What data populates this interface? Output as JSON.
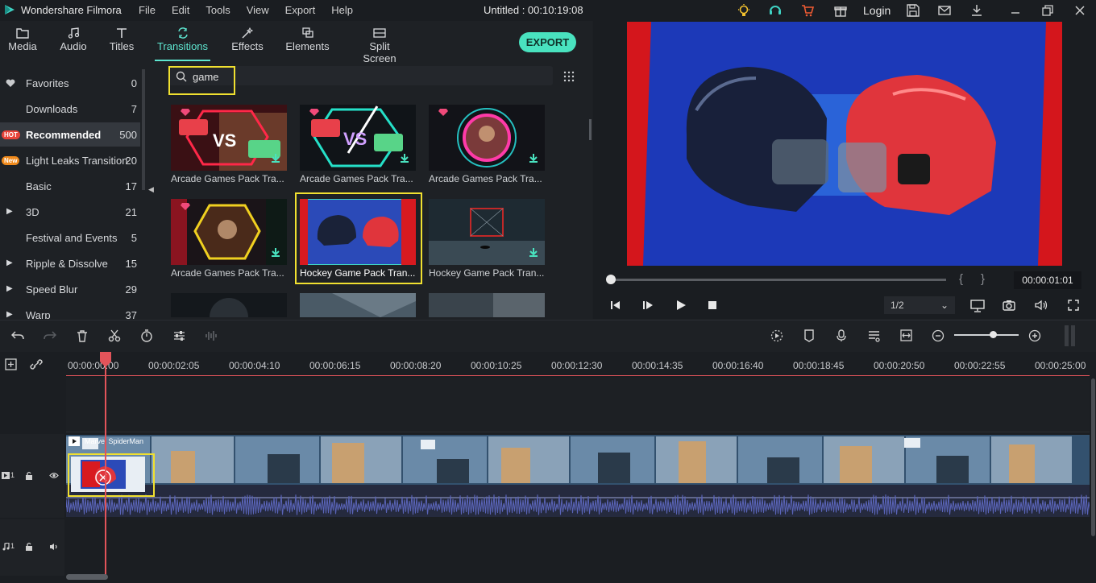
{
  "app": {
    "name": "Wondershare Filmora",
    "menus": [
      "File",
      "Edit",
      "Tools",
      "View",
      "Export",
      "Help"
    ],
    "document_title": "Untitled : 00:10:19:08",
    "login_label": "Login"
  },
  "tabs": [
    {
      "label": "Media",
      "icon": "folder-icon"
    },
    {
      "label": "Audio",
      "icon": "music-note-icon"
    },
    {
      "label": "Titles",
      "icon": "text-t-icon"
    },
    {
      "label": "Transitions",
      "icon": "transition-icon",
      "active": true
    },
    {
      "label": "Effects",
      "icon": "magic-wand-icon"
    },
    {
      "label": "Elements",
      "icon": "elements-icon"
    },
    {
      "label": "Split Screen",
      "icon": "split-screen-icon"
    }
  ],
  "export_label": "EXPORT",
  "categories": [
    {
      "label": "Favorites",
      "count": "0",
      "prefix": "heart-icon"
    },
    {
      "label": "Downloads",
      "count": "7"
    },
    {
      "label": "Recommended",
      "count": "500",
      "badge": "HOT",
      "active": true
    },
    {
      "label": "Light Leaks Transition",
      "count": "20",
      "badge": "New"
    },
    {
      "label": "Basic",
      "count": "17"
    },
    {
      "label": "3D",
      "count": "21",
      "prefix": "caret-right-icon"
    },
    {
      "label": "Festival and Events",
      "count": "5"
    },
    {
      "label": "Ripple & Dissolve",
      "count": "15",
      "prefix": "caret-right-icon"
    },
    {
      "label": "Speed Blur",
      "count": "29",
      "prefix": "caret-right-icon"
    },
    {
      "label": "Warp",
      "count": "37",
      "prefix": "caret-right-icon"
    }
  ],
  "search": {
    "value": "game",
    "placeholder": ""
  },
  "transitions": [
    {
      "name": "Arcade Games Pack Tra...",
      "premium": true
    },
    {
      "name": "Arcade Games Pack Tra...",
      "premium": true
    },
    {
      "name": "Arcade Games Pack Tra...",
      "premium": true
    },
    {
      "name": "Arcade Games Pack Tra...",
      "premium": true
    },
    {
      "name": "Hockey Game Pack Tran...",
      "premium": false,
      "selected": true
    },
    {
      "name": "Hockey Game Pack Tran...",
      "premium": false
    }
  ],
  "player": {
    "timecode": "00:00:01:01",
    "quality": "1/2",
    "progress": 0.0
  },
  "timeline": {
    "ticks": [
      "00:00:00:00",
      "00:00:02:05",
      "00:00:04:10",
      "00:00:06:15",
      "00:00:08:20",
      "00:00:10:25",
      "00:00:12:30",
      "00:00:14:35",
      "00:00:16:40",
      "00:00:18:45",
      "00:00:20:50",
      "00:00:22:55",
      "00:00:25:00"
    ],
    "clip_title": "Marvel SpiderMan",
    "video_track_label": "1",
    "audio_track_label": "1",
    "zoom_level": 0.62
  },
  "colors": {
    "accent": "#5ee6d0",
    "export": "#49e2bf",
    "highlight": "#f0e030",
    "playhead": "#e2545a"
  }
}
